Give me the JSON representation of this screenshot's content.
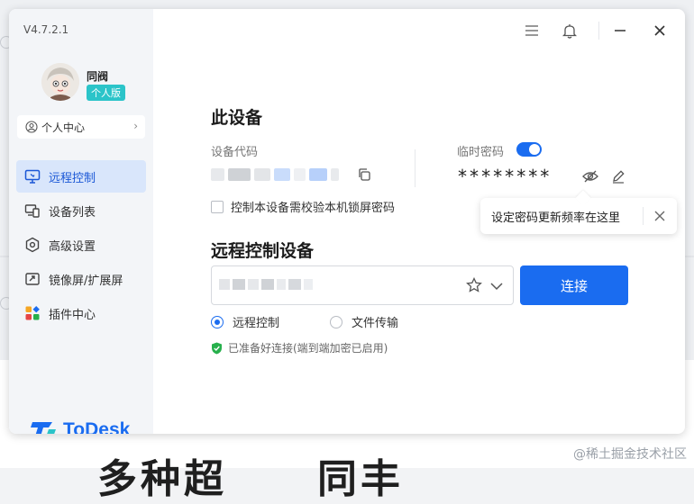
{
  "app": {
    "version": "V4.7.2.1",
    "brand": "ToDesk",
    "brand_color": "#1a6cf0"
  },
  "user": {
    "name": "同阀",
    "edition": "个人版",
    "personal_center": "个人中心"
  },
  "sidebar": {
    "items": [
      {
        "label": "远程控制",
        "icon": "monitor-icon",
        "active": true
      },
      {
        "label": "设备列表",
        "icon": "devices-icon",
        "active": false
      },
      {
        "label": "高级设置",
        "icon": "hexagon-settings-icon",
        "active": false
      },
      {
        "label": "镜像屏/扩展屏",
        "icon": "screen-share-icon",
        "active": false
      },
      {
        "label": "插件中心",
        "icon": "plugins-icon",
        "active": false
      }
    ]
  },
  "this_device": {
    "title": "此设备",
    "device_code_label": "设备代码",
    "temp_password_label": "临时密码",
    "temp_password_enabled": true,
    "password_masked": "********",
    "lock_screen_checkbox": "控制本设备需校验本机锁屏密码",
    "tooltip": "设定密码更新频率在这里"
  },
  "remote": {
    "title": "远程控制设备",
    "input_value": "",
    "connect_label": "连接",
    "modes": [
      {
        "label": "远程控制",
        "checked": true
      },
      {
        "label": "文件传输",
        "checked": false
      }
    ],
    "status": "已准备好连接(端到端加密已启用)"
  },
  "background": {
    "headline": "多种超",
    "headline_tail": "同丰",
    "watermark": "@稀土掘金技术社区"
  }
}
